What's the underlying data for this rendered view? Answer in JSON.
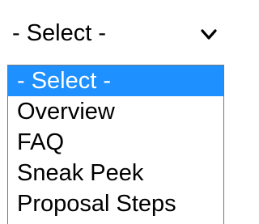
{
  "select": {
    "value": "- Select -",
    "chevron_icon": "chevron-down-icon"
  },
  "options": [
    {
      "label": "- Select -",
      "selected": true
    },
    {
      "label": "Overview",
      "selected": false
    },
    {
      "label": "FAQ",
      "selected": false
    },
    {
      "label": "Sneak Peek",
      "selected": false
    },
    {
      "label": "Proposal Steps",
      "selected": false
    }
  ],
  "colors": {
    "selected_bg": "#1e90ff",
    "selected_text": "#ffffff",
    "text": "#000000",
    "border": "#767676"
  }
}
